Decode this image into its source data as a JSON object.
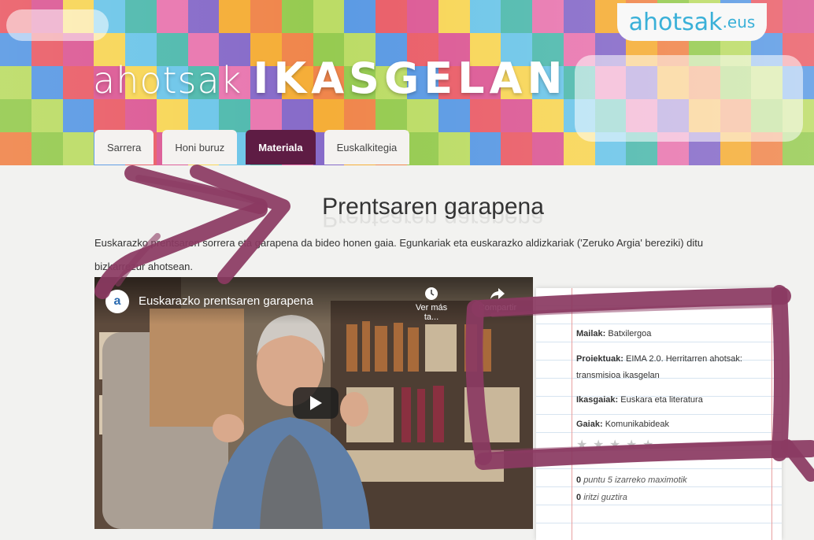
{
  "header": {
    "logo_text": "ahotsak",
    "logo_suffix": ".eus",
    "title_light": "ahotsak",
    "title_bold": "IKASGELAN"
  },
  "nav": {
    "tabs": [
      {
        "label": "Sarrera",
        "active": false
      },
      {
        "label": "Honi buruz",
        "active": false
      },
      {
        "label": "Materiala",
        "active": true
      },
      {
        "label": "Euskalkitegia",
        "active": false
      }
    ]
  },
  "main": {
    "title": "Prentsaren garapena",
    "intro": "Euskarazko prentsaren sorrera eta garapena da bideo honen gaia. Egunkariak eta euskarazko aldizkariak ('Zeruko Argia' bereziki) ditu bizkarrezur ahotsean."
  },
  "video": {
    "title": "Euskarazko prentsaren garapena",
    "watch_later_label": "Ver más ta...",
    "share_label": "Compartir"
  },
  "info": {
    "mailak_label": "Mailak:",
    "mailak_value": "Batxilergoa",
    "proiektuak_label": "Proiektuak:",
    "proiektuak_value": "EIMA 2.0. Herritarren ahotsak: transmisioa ikasgelan",
    "ikasgaiak_label": "Ikasgaiak:",
    "ikasgaiak_value": "Euskara eta literatura",
    "gaiak_label": "Gaiak:",
    "gaiak_value": "Komunikabideak",
    "stars_total": 5,
    "stars_filled": 0,
    "points_value": "0",
    "points_text": "puntu 5 izarreko maximotik",
    "opinions_value": "0",
    "opinions_text": "iritzi guztira"
  },
  "colors": {
    "accent": "#5e1c44",
    "annotation": "#8b3a62",
    "logo": "#3ab0d8"
  }
}
